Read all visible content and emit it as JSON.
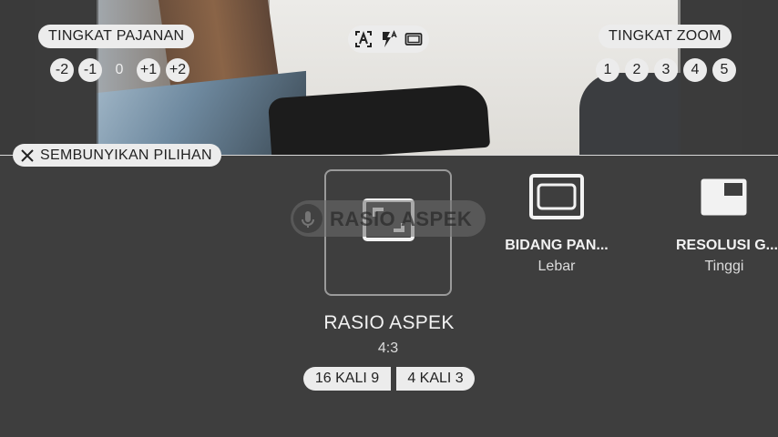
{
  "exposure": {
    "title": "TINGKAT PAJANAN",
    "values": [
      "-2",
      "-1",
      "0",
      "+1",
      "+2"
    ],
    "selected": "0"
  },
  "zoom": {
    "title": "TINGKAT ZOOM",
    "values": [
      "1",
      "2",
      "3",
      "4",
      "5"
    ]
  },
  "quick_icons": [
    "auto-scene-icon",
    "flash-auto-icon",
    "aspect-frame-icon"
  ],
  "hide_options": {
    "label": "SEMBUNYIKAN PILIHAN"
  },
  "overlay": {
    "label": "RASIO ASPEK"
  },
  "settings": {
    "aspect": {
      "title": "RASIO ASPEK",
      "value": "4:3",
      "options": [
        "16 KALI 9",
        "4 KALI 3"
      ]
    },
    "field": {
      "title": "BIDANG PAN...",
      "value": "Lebar"
    },
    "resolution": {
      "title": "RESOLUSI G...",
      "value": "Tinggi"
    }
  },
  "colors": {
    "background": "#3e3e3e",
    "pill": "#ececec",
    "text": "#f2f2f2"
  }
}
